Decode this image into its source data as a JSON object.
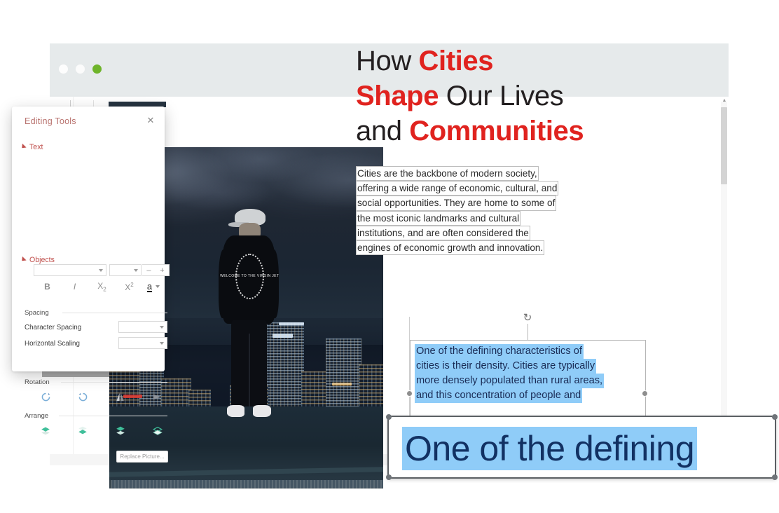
{
  "window": {
    "traffic_lights": [
      "minimize-dot",
      "maximize-dot",
      "close-dot"
    ],
    "green_hex": "#6eb42a"
  },
  "panel": {
    "title": "Editing Tools",
    "close_icon": "✕",
    "sections": [
      {
        "key": "text",
        "label": "Text"
      },
      {
        "key": "objects",
        "label": "Objects"
      }
    ],
    "font": {
      "name_value": "",
      "name_placeholder": "",
      "size_value": "",
      "size_placeholder": "",
      "decrease_label": "–",
      "increase_label": "+"
    },
    "format_buttons": [
      {
        "name": "bold",
        "label": "B"
      },
      {
        "name": "italic",
        "label": "I"
      },
      {
        "name": "subscript",
        "label": "X"
      },
      {
        "name": "superscript",
        "label": "X"
      }
    ],
    "format_sub": "2",
    "format_sup": "2",
    "font_color_label": "a",
    "spacing": {
      "group_label": "Spacing",
      "rows": [
        {
          "label": "Character Spacing",
          "value": ""
        },
        {
          "label": "Horizontal Scaling",
          "value": ""
        }
      ]
    },
    "rotation": {
      "group_label": "Rotation",
      "buttons": [
        "rotate-right-icon",
        "rotate-left-icon",
        "flip-vertical-icon",
        "flip-horizontal-icon"
      ]
    },
    "arrange": {
      "group_label": "Arrange",
      "buttons": [
        "bring-to-front-icon",
        "send-to-back-icon",
        "bring-forward-icon",
        "send-backward-icon"
      ]
    },
    "replace_picture_label": "Replace Picture..."
  },
  "document": {
    "headline": {
      "lines": [
        [
          {
            "text": "How ",
            "accent": false
          },
          {
            "text": "Cities",
            "accent": true
          }
        ],
        [
          {
            "text": "Shape",
            "accent": true
          },
          {
            "text": " Our Lives",
            "accent": false
          }
        ],
        [
          {
            "text": "and ",
            "accent": false
          },
          {
            "text": "Communities",
            "accent": true
          }
        ]
      ],
      "accent_hex": "#e0231f",
      "base_hex": "#231f20"
    },
    "paragraph_1_lines": [
      "Cities are the backbone of modern society,",
      "offering a wide range of economic, cultural, and",
      "social opportunities. They are home to some of",
      "the most iconic landmarks and cultural",
      "institutions, and are often considered the",
      "engines of economic growth and innovation."
    ],
    "paragraph_2_lines": [
      "One of the defining characteristics of",
      "cities is their density. Cities are typically",
      "more densely populated than rural areas,",
      "and this concentration of people and"
    ],
    "selection_hex": "#8fccf8",
    "selection_text_hex": "#1a2c56",
    "rotation_handle_icon": "↻",
    "photo": {
      "alt_name": "rooftop-city-night-photo",
      "hoodie_logo_text": "WELCOME TO THE VIRGIN JET"
    }
  },
  "callout": {
    "text": "One of the defining",
    "highlight_hex": "#8fccf8",
    "text_hex": "#123163",
    "border_hex": "#5b5f63"
  },
  "scrollbar": {
    "up_arrow_icon": "▲",
    "thumb_name": "vertical-scroll-thumb"
  }
}
